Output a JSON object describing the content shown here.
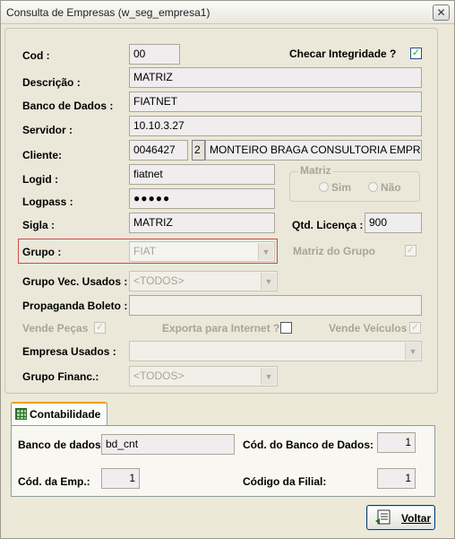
{
  "window": {
    "title": "Consulta de Empresas (w_seg_empresa1)",
    "close_glyph": "✕"
  },
  "form": {
    "cod": {
      "label": "Cod :",
      "value": "00"
    },
    "checar": {
      "label": "Checar Integridade  ?",
      "checked": true
    },
    "descricao": {
      "label": "Descrição :",
      "value": "MATRIZ"
    },
    "banco": {
      "label": "Banco de Dados :",
      "value": "FIATNET"
    },
    "servidor": {
      "label": "Servidor :",
      "value": "10.10.3.27"
    },
    "cliente": {
      "label": "Cliente:",
      "code": "0046427",
      "lookup": "2",
      "name": "MONTEIRO BRAGA CONSULTORIA EMPRE"
    },
    "logid": {
      "label": "Logid :",
      "value": "fiatnet"
    },
    "logpass": {
      "label": "Logpass :",
      "value": "●●●●●"
    },
    "sigla": {
      "label": "Sigla :",
      "value": "MATRIZ"
    },
    "matriz": {
      "title": "Matriz",
      "sim": "Sim",
      "nao": "Não"
    },
    "licenca": {
      "label": "Qtd. Licença :",
      "value": "900"
    },
    "grupo": {
      "label": "Grupo :",
      "value": "FIAT"
    },
    "matriz_grupo": {
      "label": "Matriz do Grupo",
      "checked": true
    },
    "grupo_vec": {
      "label": "Grupo Vec. Usados :",
      "value": "<TODOS>"
    },
    "propaganda": {
      "label": "Propaganda Boleto :",
      "value": ""
    },
    "vende_pecas": {
      "label": "Vende Peças",
      "checked": true
    },
    "exporta": {
      "label": "Exporta para Internet ?",
      "checked": false
    },
    "vende_veiculos": {
      "label": "Vende Veículos",
      "checked": true
    },
    "empresa_usados": {
      "label": "Empresa Usados :",
      "value": ""
    },
    "grupo_financ": {
      "label": "Grupo Financ.:",
      "value": "<TODOS>"
    }
  },
  "tabs": [
    {
      "label": "Contabilidade",
      "icon": "ledger-icon"
    }
  ],
  "contabilidade": {
    "banco": {
      "label": "Banco de dados:",
      "value": "bd_cnt"
    },
    "cod_banco": {
      "label": "Cód. do Banco de Dados:",
      "value": "1"
    },
    "cod_emp": {
      "label": "Cód. da Emp.:",
      "value": "1"
    },
    "cod_filial": {
      "label": "Código da Filial:",
      "value": "1"
    }
  },
  "buttons": {
    "voltar": "Voltar"
  },
  "icons": {
    "check_glyph": "✓",
    "arrow_glyph": "▼"
  },
  "colors": {
    "accent_tab": "#f0a000",
    "highlight_border": "#d14a4a",
    "check": "#21a121"
  }
}
